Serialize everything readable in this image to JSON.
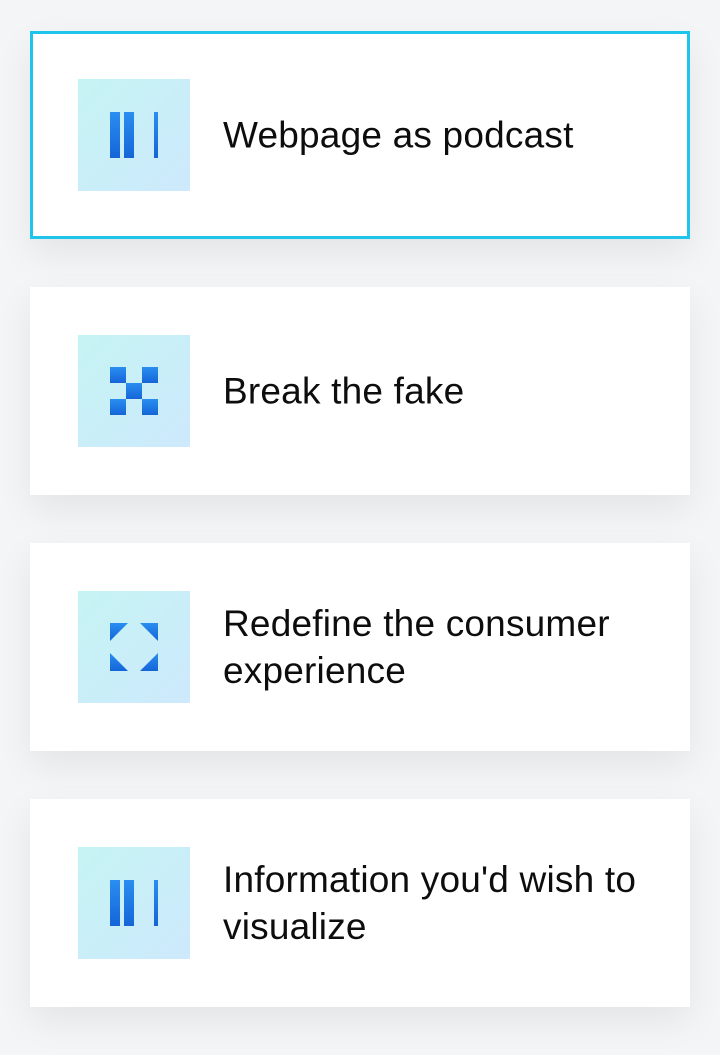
{
  "items": [
    {
      "label": "Webpage as podcast",
      "icon": "bars-icon",
      "selected": true
    },
    {
      "label": "Break the fake",
      "icon": "checker-icon",
      "selected": false
    },
    {
      "label": "Redefine the consumer experience",
      "icon": "corners-icon",
      "selected": false
    },
    {
      "label": "Information you'd wish to visualize",
      "icon": "bars-icon",
      "selected": false
    }
  ],
  "colors": {
    "selected_border": "#1ec4ea",
    "icon_blue": "#1a73e8",
    "icon_bg_start": "#c6f4f4",
    "icon_bg_end": "#cde9fc"
  }
}
